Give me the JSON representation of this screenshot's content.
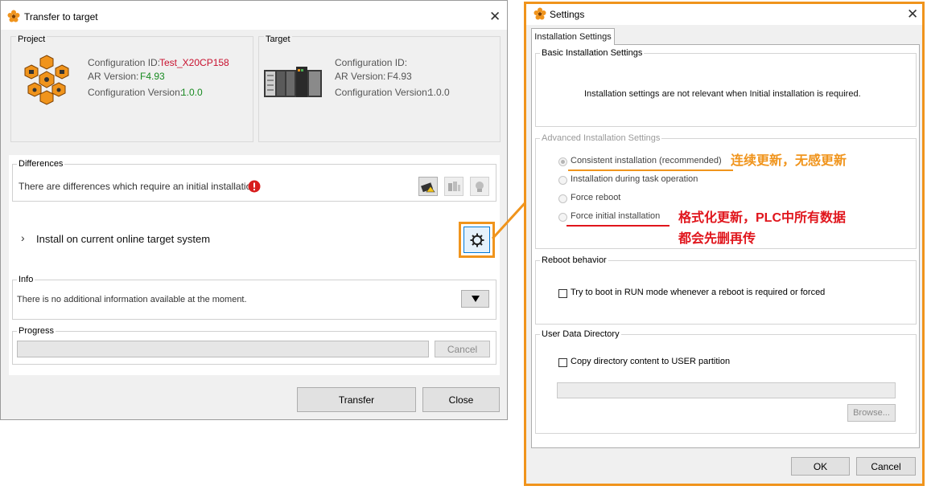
{
  "transfer_dialog": {
    "title": "Transfer to target",
    "project": {
      "legend": "Project",
      "config_id_label": "Configuration ID:",
      "config_id_value": "Test_X20CP158",
      "ar_label": "AR Version:",
      "ar_value": "F4.93",
      "config_version_label": "Configuration Version:",
      "config_version_value": "1.0.0"
    },
    "target": {
      "legend": "Target",
      "config_id_label": "Configuration ID:",
      "ar_label": "AR Version:",
      "ar_value": "F4.93",
      "config_version_label": "Configuration Version:",
      "config_version_value": "1.0.0"
    },
    "differences": {
      "legend": "Differences",
      "message": "There are differences which require an initial installation."
    },
    "install_line": "Install on current online target system",
    "info": {
      "legend": "Info",
      "message": "There is no additional information available at the moment."
    },
    "progress": {
      "legend": "Progress",
      "value": 0,
      "cancel_label": "Cancel"
    },
    "buttons": {
      "transfer": "Transfer",
      "close": "Close"
    }
  },
  "settings_dialog": {
    "title": "Settings",
    "tab": "Installation Settings",
    "basic": {
      "legend": "Basic Installation Settings",
      "message": "Installation settings are not relevant when Initial installation is required."
    },
    "advanced": {
      "legend": "Advanced Installation Settings",
      "options": [
        {
          "label": "Consistent installation (recommended)",
          "selected": true
        },
        {
          "label": "Installation during task operation",
          "selected": false
        },
        {
          "label": "Force reboot",
          "selected": false
        },
        {
          "label": "Force initial installation",
          "selected": false
        }
      ]
    },
    "reboot": {
      "legend": "Reboot behavior",
      "checkbox_label": "Try to boot in RUN mode whenever a reboot is required or forced",
      "checked": false
    },
    "user_data": {
      "legend": "User Data Directory",
      "checkbox_label": "Copy directory content to USER partition",
      "checked": false,
      "path_value": "",
      "browse_label": "Browse..."
    },
    "buttons": {
      "ok": "OK",
      "cancel": "Cancel"
    }
  },
  "annotations": {
    "consistent_note": "连续更新，无感更新",
    "initial_note_line1": "格式化更新，PLC中所有数据",
    "initial_note_line2": "都会先删再传"
  },
  "colors": {
    "accent_orange": "#f0941c",
    "annotation_red": "#e0151c",
    "config_id_red": "#c8102e",
    "version_green": "#178a20"
  },
  "icons": {
    "app": "br-automation-flower-icon",
    "warning": "red-exclamation-icon",
    "settings": "gear-icon",
    "expand": "chevron-right-icon",
    "dropdown": "triangle-down-icon"
  }
}
